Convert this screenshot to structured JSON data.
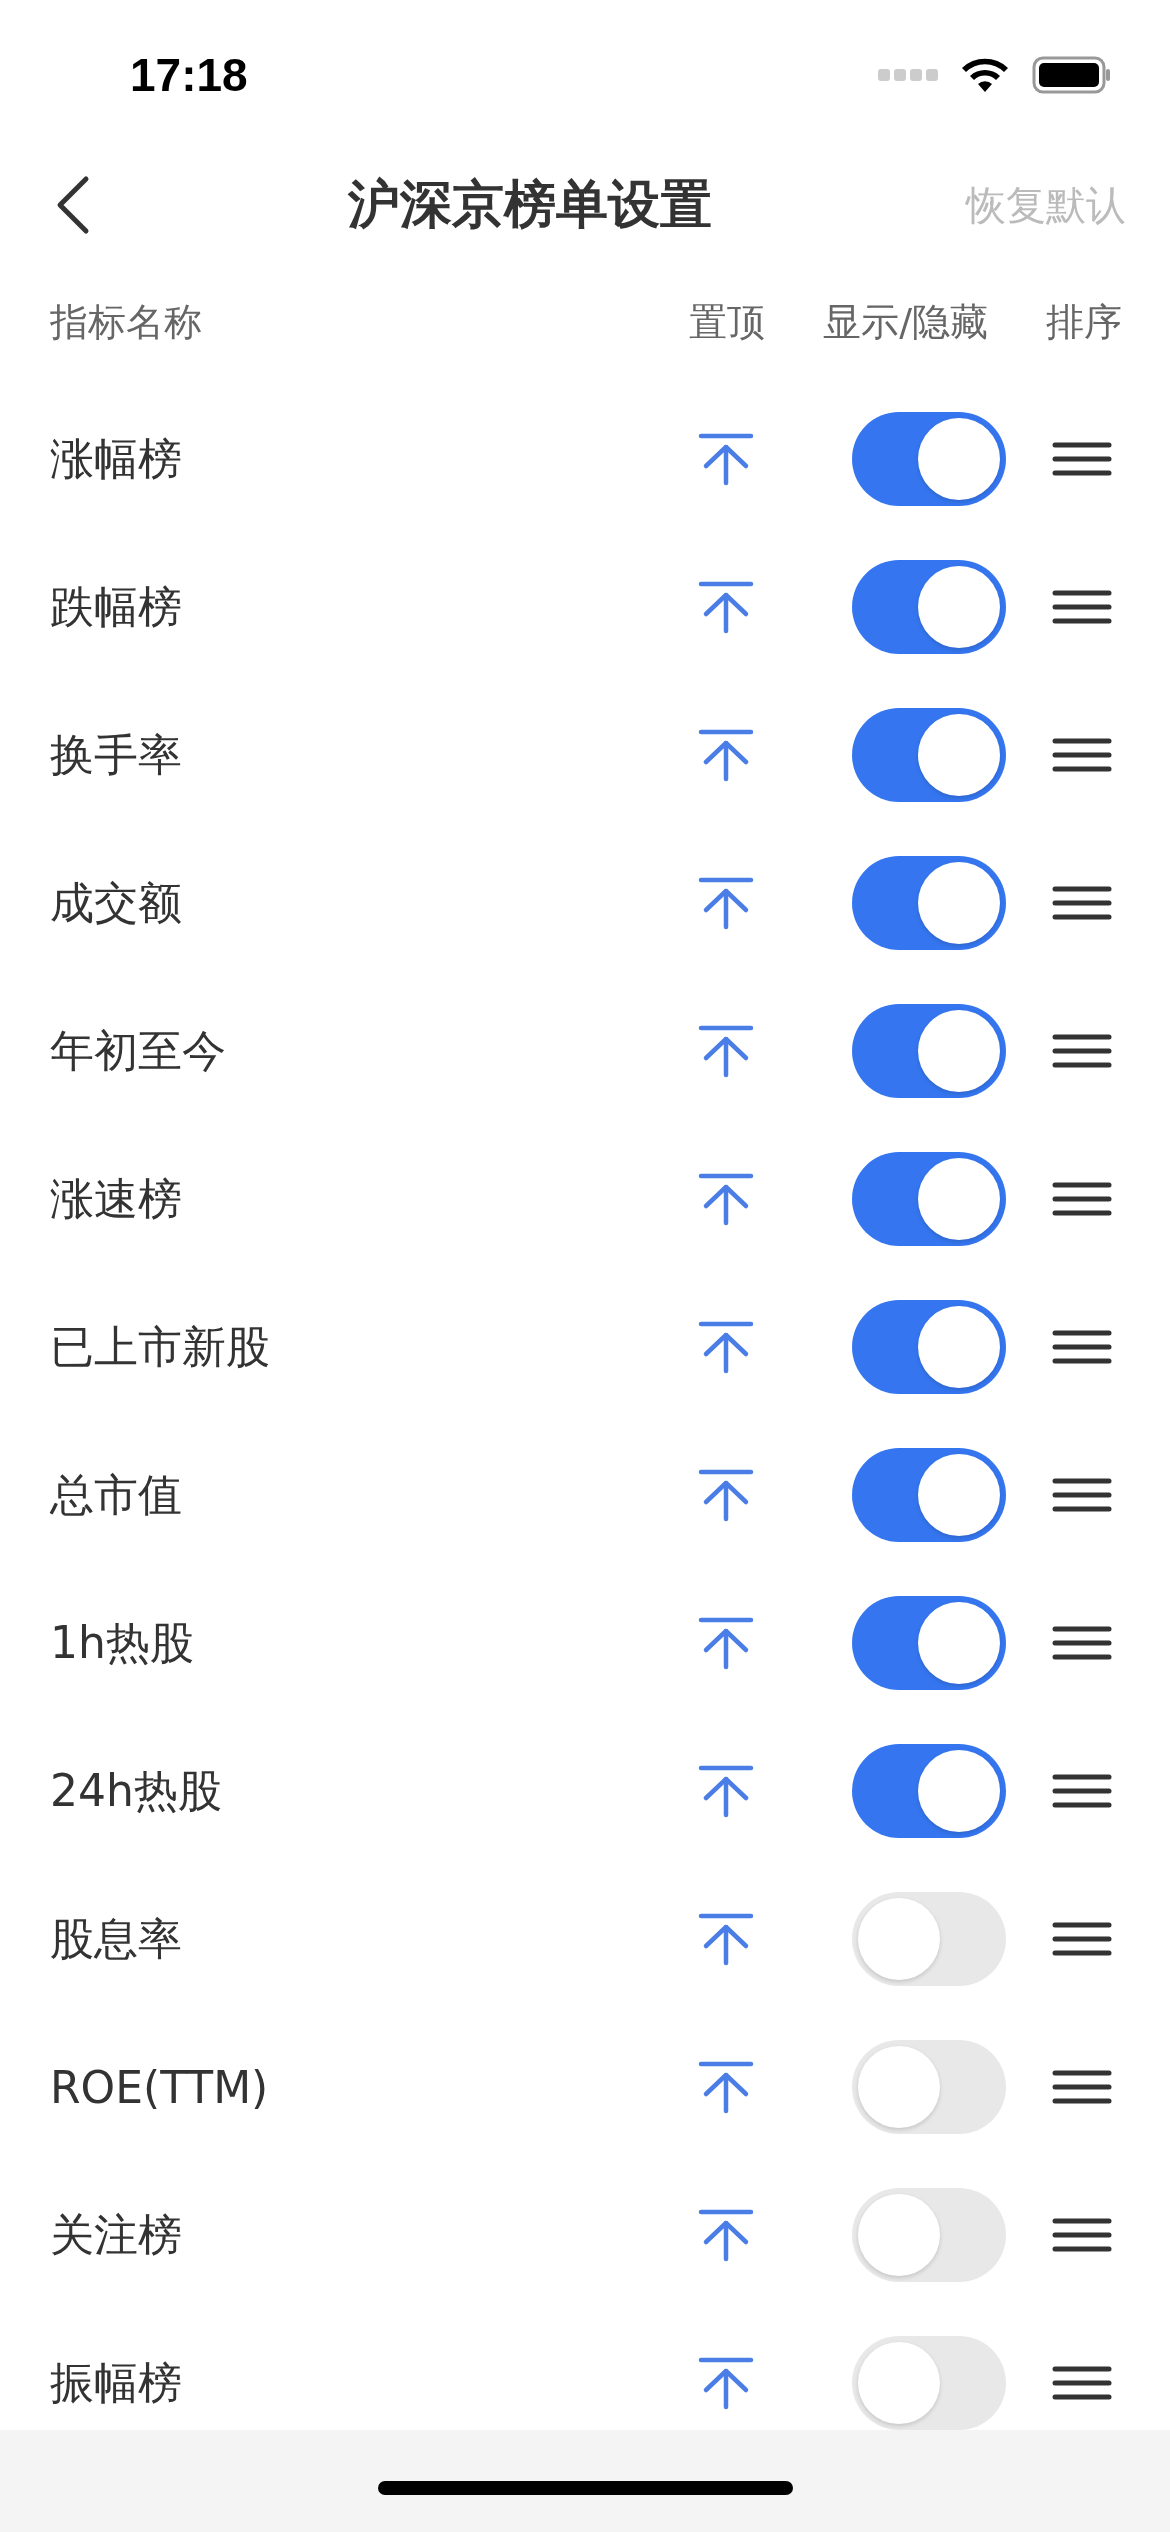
{
  "status_bar": {
    "time": "17:18"
  },
  "nav": {
    "title": "沪深京榜单设置",
    "action": "恢复默认"
  },
  "columns": [
    "指标名称",
    "置顶",
    "显示/隐藏",
    "排序"
  ],
  "rows": [
    {
      "name": "涨幅榜",
      "shown": true
    },
    {
      "name": "跌幅榜",
      "shown": true
    },
    {
      "name": "换手率",
      "shown": true
    },
    {
      "name": "成交额",
      "shown": true
    },
    {
      "name": "年初至今",
      "shown": true
    },
    {
      "name": "涨速榜",
      "shown": true
    },
    {
      "name": "已上市新股",
      "shown": true
    },
    {
      "name": "总市值",
      "shown": true
    },
    {
      "name": "1h热股",
      "shown": true
    },
    {
      "name": "24h热股",
      "shown": true
    },
    {
      "name": "股息率",
      "shown": false
    },
    {
      "name": "ROE(TTM)",
      "shown": false
    },
    {
      "name": "关注榜",
      "shown": false
    },
    {
      "name": "振幅榜",
      "shown": false
    }
  ]
}
